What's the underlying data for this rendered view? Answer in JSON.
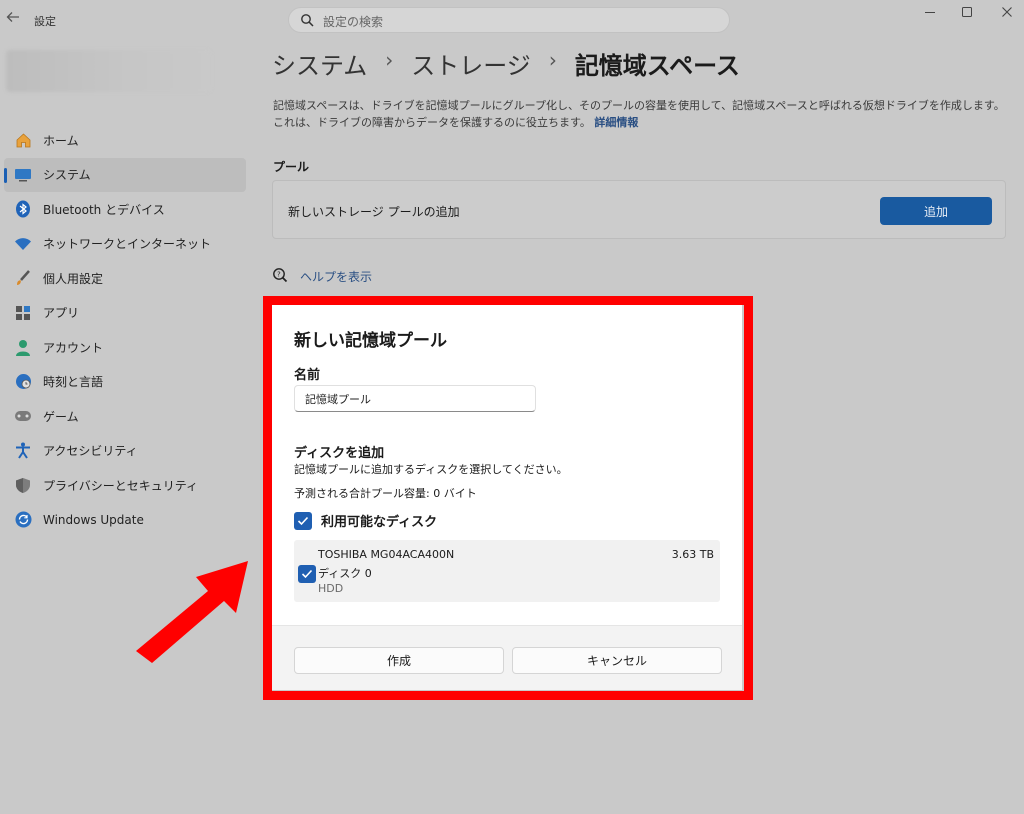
{
  "window": {
    "app_title": "設定"
  },
  "search": {
    "placeholder": "設定の検索"
  },
  "sidebar": {
    "items": [
      {
        "label": "ホーム",
        "icon": "home-icon"
      },
      {
        "label": "システム",
        "icon": "monitor-icon"
      },
      {
        "label": "Bluetooth とデバイス",
        "icon": "bluetooth-icon"
      },
      {
        "label": "ネットワークとインターネット",
        "icon": "wifi-icon"
      },
      {
        "label": "個人用設定",
        "icon": "brush-icon"
      },
      {
        "label": "アプリ",
        "icon": "apps-icon"
      },
      {
        "label": "アカウント",
        "icon": "account-icon"
      },
      {
        "label": "時刻と言語",
        "icon": "globe-clock-icon"
      },
      {
        "label": "ゲーム",
        "icon": "gamepad-icon"
      },
      {
        "label": "アクセシビリティ",
        "icon": "accessibility-icon"
      },
      {
        "label": "プライバシーとセキュリティ",
        "icon": "shield-icon"
      },
      {
        "label": "Windows Update",
        "icon": "update-icon"
      }
    ],
    "active_index": 1
  },
  "breadcrumb": {
    "part1": "システム",
    "part2": "ストレージ",
    "current": "記憶域スペース",
    "separator": "›"
  },
  "description": {
    "text": "記憶域スペースは、ドライブを記憶域プールにグループ化し、そのプールの容量を使用して、記憶域スペースと呼ばれる仮想ドライブを作成します。これは、ドライブの障害からデータを保護するのに役立ちます。",
    "link": "詳細情報"
  },
  "pool_section": {
    "label": "プール",
    "row_label": "新しいストレージ プールの追加",
    "add_button": "追加"
  },
  "help": {
    "label": "ヘルプを表示"
  },
  "dialog": {
    "title": "新しい記憶域プール",
    "name_label": "名前",
    "name_value": "記憶域プール",
    "add_disks_label": "ディスクを追加",
    "add_disks_desc": "記憶域プールに追加するディスクを選択してください。",
    "estimated": "予測される合計プール容量: 0 バイト",
    "available_label": "利用可能なディスク",
    "disks": [
      {
        "name": "TOSHIBA MG04ACA400N",
        "sub": "ディスク 0",
        "type": "HDD",
        "size": "3.63 TB",
        "checked": true
      }
    ],
    "create_button": "作成",
    "cancel_button": "キャンセル"
  },
  "colors": {
    "highlight_frame": "#ff0000",
    "accent": "#195aa0",
    "arrow": "#ff0000"
  }
}
